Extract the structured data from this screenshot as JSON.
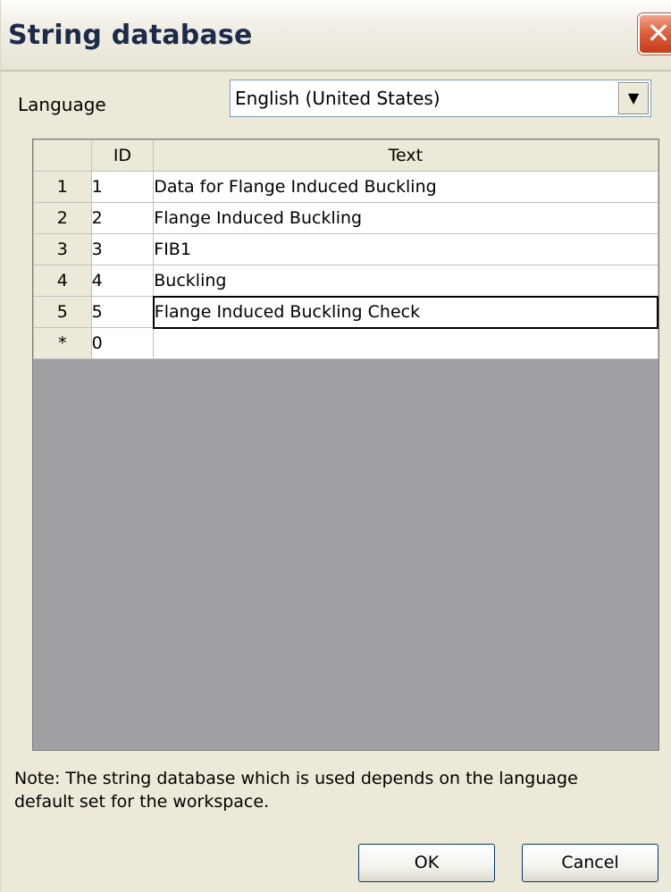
{
  "window": {
    "title": "String database",
    "close_glyph": "✕"
  },
  "language": {
    "label": "Language",
    "selected": "English (United States)"
  },
  "grid": {
    "headers": {
      "row": "",
      "id": "ID",
      "text": "Text"
    },
    "rows": [
      {
        "row": "1",
        "id": "1",
        "text": "Data for Flange Induced Buckling"
      },
      {
        "row": "2",
        "id": "2",
        "text": "Flange Induced Buckling"
      },
      {
        "row": "3",
        "id": "3",
        "text": "FIB1"
      },
      {
        "row": "4",
        "id": "4",
        "text": "Buckling"
      },
      {
        "row": "5",
        "id": "5",
        "text": "Flange Induced Buckling Check"
      },
      {
        "row": "*",
        "id": "0",
        "text": ""
      }
    ]
  },
  "note": "Note: The string database which is used depends on the language default set for the workspace.",
  "buttons": {
    "ok": "OK",
    "cancel": "Cancel"
  }
}
